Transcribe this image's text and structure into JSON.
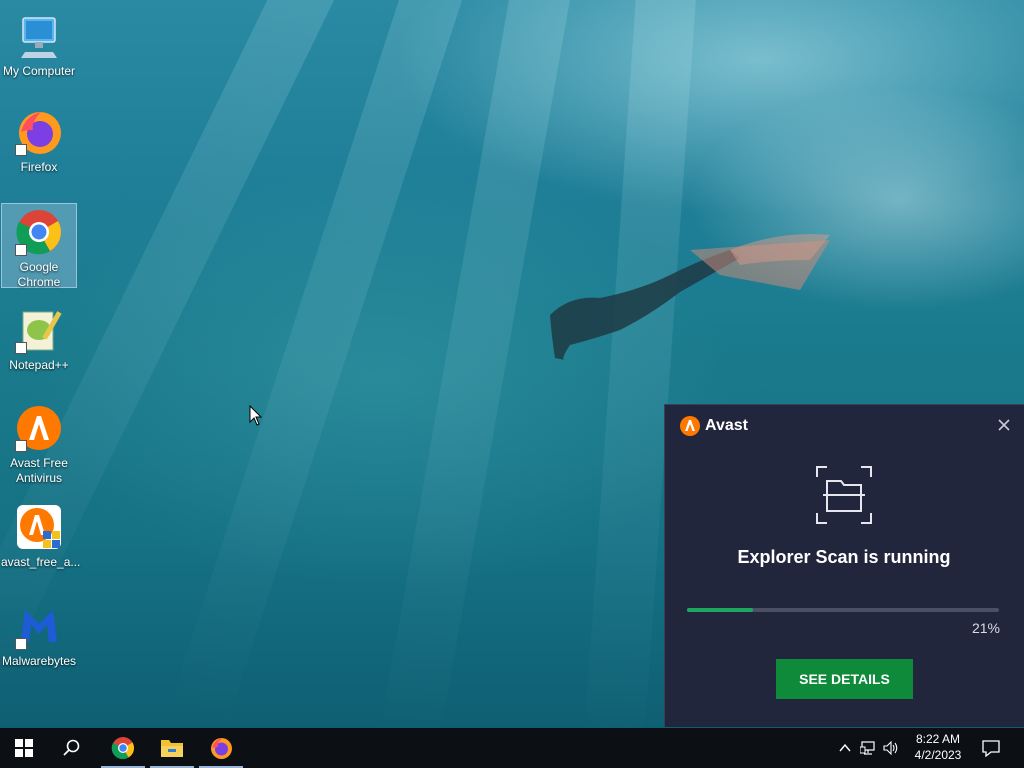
{
  "desktop": {
    "icons": [
      {
        "label": "My Computer",
        "icon": "computer-icon"
      },
      {
        "label": "Firefox",
        "icon": "firefox-icon"
      },
      {
        "label": "Google Chrome",
        "icon": "chrome-icon"
      },
      {
        "label": "Notepad++",
        "icon": "notepadpp-icon"
      },
      {
        "label": "Avast Free Antivirus",
        "icon": "avast-icon"
      },
      {
        "label": "avast_free_a...",
        "icon": "avast-installer-icon"
      },
      {
        "label": "Malwarebytes",
        "icon": "malwarebytes-icon"
      }
    ]
  },
  "avast_popup": {
    "brand": "Avast",
    "title": "Explorer Scan is running",
    "progress_percent": 21,
    "progress_label": "21%",
    "button_label": "SEE DETAILS",
    "colors": {
      "background": "#22263d",
      "accent": "#ff7800",
      "progress": "#1fa760",
      "button": "#0f8a3a"
    }
  },
  "taskbar": {
    "apps": [
      "start-icon",
      "search-icon",
      "chrome-icon",
      "file-explorer-icon",
      "firefox-icon"
    ],
    "clock_time": "8:22 AM",
    "clock_date": "4/2/2023"
  }
}
